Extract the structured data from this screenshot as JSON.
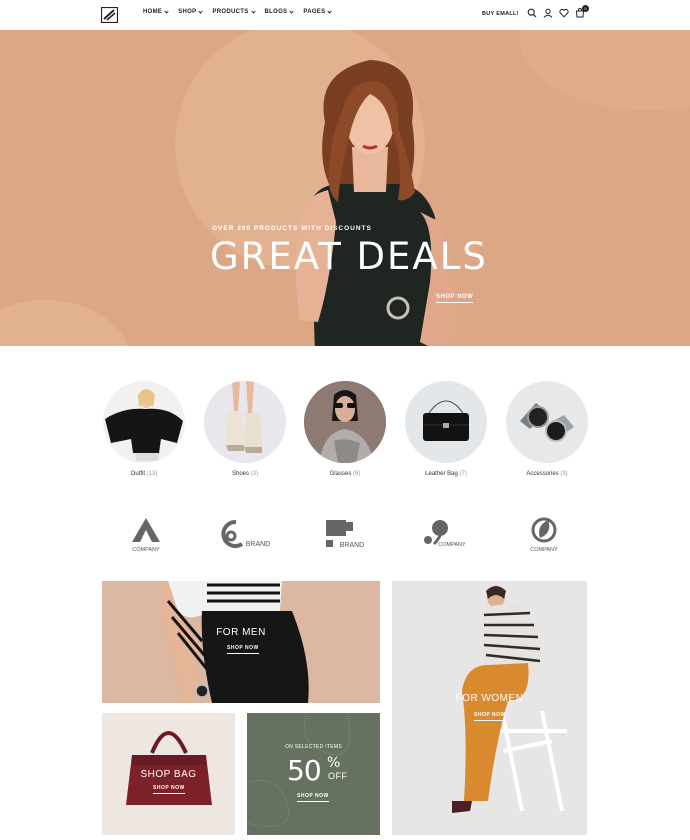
{
  "header": {
    "nav": [
      "HOME",
      "SHOP",
      "PRODUCTS",
      "BLOGS",
      "PAGES"
    ],
    "buy_label": "BUY EMALL!",
    "cart_count": "0",
    "icons": [
      "search-icon",
      "user-icon",
      "heart-icon",
      "cart-icon"
    ]
  },
  "hero": {
    "subtitle": "OVER 200 PRODUCTS WITH DISCOUNTS",
    "title": "GREAT DEALS",
    "cta": "SHOP NOW",
    "bg_color": "#dca785"
  },
  "categories": [
    {
      "name": "Outfit",
      "count": "(13)"
    },
    {
      "name": "Shoes",
      "count": "(3)"
    },
    {
      "name": "Glasses",
      "count": "(6)"
    },
    {
      "name": "Leather Bag",
      "count": "(7)"
    },
    {
      "name": "Accessories",
      "count": "(3)"
    }
  ],
  "brands": [
    "COMPANY",
    "BRAND",
    "BRAND",
    "COMPANY",
    "COMPANY"
  ],
  "banners": {
    "men": {
      "title": "FOR MEN",
      "cta": "SHOP NOW"
    },
    "women": {
      "title": "FOR WOMEN",
      "cta": "SHOP NOW"
    },
    "bag": {
      "title": "SHOP BAG",
      "cta": "SHOP NOW"
    },
    "sale": {
      "pre": "ON SELECTED ITEMS",
      "num": "50",
      "pct": "%",
      "off": "OFF",
      "cta": "SHOP NOW"
    }
  }
}
